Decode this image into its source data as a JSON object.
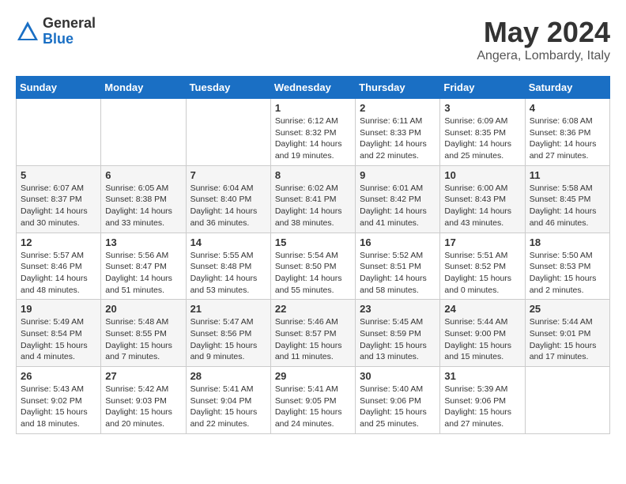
{
  "header": {
    "logo_general": "General",
    "logo_blue": "Blue",
    "month_year": "May 2024",
    "location": "Angera, Lombardy, Italy"
  },
  "days_of_week": [
    "Sunday",
    "Monday",
    "Tuesday",
    "Wednesday",
    "Thursday",
    "Friday",
    "Saturday"
  ],
  "weeks": [
    [
      {
        "day": "",
        "info": ""
      },
      {
        "day": "",
        "info": ""
      },
      {
        "day": "",
        "info": ""
      },
      {
        "day": "1",
        "info": "Sunrise: 6:12 AM\nSunset: 8:32 PM\nDaylight: 14 hours\nand 19 minutes."
      },
      {
        "day": "2",
        "info": "Sunrise: 6:11 AM\nSunset: 8:33 PM\nDaylight: 14 hours\nand 22 minutes."
      },
      {
        "day": "3",
        "info": "Sunrise: 6:09 AM\nSunset: 8:35 PM\nDaylight: 14 hours\nand 25 minutes."
      },
      {
        "day": "4",
        "info": "Sunrise: 6:08 AM\nSunset: 8:36 PM\nDaylight: 14 hours\nand 27 minutes."
      }
    ],
    [
      {
        "day": "5",
        "info": "Sunrise: 6:07 AM\nSunset: 8:37 PM\nDaylight: 14 hours\nand 30 minutes."
      },
      {
        "day": "6",
        "info": "Sunrise: 6:05 AM\nSunset: 8:38 PM\nDaylight: 14 hours\nand 33 minutes."
      },
      {
        "day": "7",
        "info": "Sunrise: 6:04 AM\nSunset: 8:40 PM\nDaylight: 14 hours\nand 36 minutes."
      },
      {
        "day": "8",
        "info": "Sunrise: 6:02 AM\nSunset: 8:41 PM\nDaylight: 14 hours\nand 38 minutes."
      },
      {
        "day": "9",
        "info": "Sunrise: 6:01 AM\nSunset: 8:42 PM\nDaylight: 14 hours\nand 41 minutes."
      },
      {
        "day": "10",
        "info": "Sunrise: 6:00 AM\nSunset: 8:43 PM\nDaylight: 14 hours\nand 43 minutes."
      },
      {
        "day": "11",
        "info": "Sunrise: 5:58 AM\nSunset: 8:45 PM\nDaylight: 14 hours\nand 46 minutes."
      }
    ],
    [
      {
        "day": "12",
        "info": "Sunrise: 5:57 AM\nSunset: 8:46 PM\nDaylight: 14 hours\nand 48 minutes."
      },
      {
        "day": "13",
        "info": "Sunrise: 5:56 AM\nSunset: 8:47 PM\nDaylight: 14 hours\nand 51 minutes."
      },
      {
        "day": "14",
        "info": "Sunrise: 5:55 AM\nSunset: 8:48 PM\nDaylight: 14 hours\nand 53 minutes."
      },
      {
        "day": "15",
        "info": "Sunrise: 5:54 AM\nSunset: 8:50 PM\nDaylight: 14 hours\nand 55 minutes."
      },
      {
        "day": "16",
        "info": "Sunrise: 5:52 AM\nSunset: 8:51 PM\nDaylight: 14 hours\nand 58 minutes."
      },
      {
        "day": "17",
        "info": "Sunrise: 5:51 AM\nSunset: 8:52 PM\nDaylight: 15 hours\nand 0 minutes."
      },
      {
        "day": "18",
        "info": "Sunrise: 5:50 AM\nSunset: 8:53 PM\nDaylight: 15 hours\nand 2 minutes."
      }
    ],
    [
      {
        "day": "19",
        "info": "Sunrise: 5:49 AM\nSunset: 8:54 PM\nDaylight: 15 hours\nand 4 minutes."
      },
      {
        "day": "20",
        "info": "Sunrise: 5:48 AM\nSunset: 8:55 PM\nDaylight: 15 hours\nand 7 minutes."
      },
      {
        "day": "21",
        "info": "Sunrise: 5:47 AM\nSunset: 8:56 PM\nDaylight: 15 hours\nand 9 minutes."
      },
      {
        "day": "22",
        "info": "Sunrise: 5:46 AM\nSunset: 8:57 PM\nDaylight: 15 hours\nand 11 minutes."
      },
      {
        "day": "23",
        "info": "Sunrise: 5:45 AM\nSunset: 8:59 PM\nDaylight: 15 hours\nand 13 minutes."
      },
      {
        "day": "24",
        "info": "Sunrise: 5:44 AM\nSunset: 9:00 PM\nDaylight: 15 hours\nand 15 minutes."
      },
      {
        "day": "25",
        "info": "Sunrise: 5:44 AM\nSunset: 9:01 PM\nDaylight: 15 hours\nand 17 minutes."
      }
    ],
    [
      {
        "day": "26",
        "info": "Sunrise: 5:43 AM\nSunset: 9:02 PM\nDaylight: 15 hours\nand 18 minutes."
      },
      {
        "day": "27",
        "info": "Sunrise: 5:42 AM\nSunset: 9:03 PM\nDaylight: 15 hours\nand 20 minutes."
      },
      {
        "day": "28",
        "info": "Sunrise: 5:41 AM\nSunset: 9:04 PM\nDaylight: 15 hours\nand 22 minutes."
      },
      {
        "day": "29",
        "info": "Sunrise: 5:41 AM\nSunset: 9:05 PM\nDaylight: 15 hours\nand 24 minutes."
      },
      {
        "day": "30",
        "info": "Sunrise: 5:40 AM\nSunset: 9:06 PM\nDaylight: 15 hours\nand 25 minutes."
      },
      {
        "day": "31",
        "info": "Sunrise: 5:39 AM\nSunset: 9:06 PM\nDaylight: 15 hours\nand 27 minutes."
      },
      {
        "day": "",
        "info": ""
      }
    ]
  ]
}
